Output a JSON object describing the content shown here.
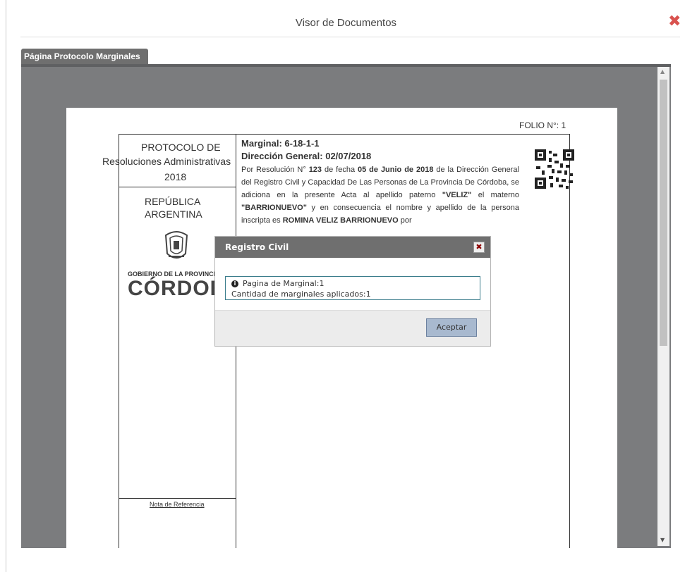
{
  "window": {
    "title": "Visor de Documentos",
    "close_icon": "close-icon",
    "close_color": "#d9534f"
  },
  "tabs": [
    {
      "label": "Página Protocolo Marginales",
      "active": true
    }
  ],
  "document": {
    "folio": "FOLIO N°: 1",
    "left_panel": {
      "protocol_line": "PROTOCOLO DE",
      "resolution_line": "Resoluciones Administrativas",
      "year": "2018",
      "country_line1": "REPÚBLICA",
      "country_line2": "ARGENTINA",
      "government_label": "GOBIERNO DE LA PROVINCIA",
      "province": "CÓRDOBA",
      "reference_note": "Nota de Referencia"
    },
    "marginal": {
      "title": "Marginal: 6-18-1-1",
      "direction": "Dirección General: 02/07/2018",
      "text_parts": {
        "p1": "Por Resolución N° ",
        "b1": "123",
        "p2": " de fecha ",
        "b2": "05 de Junio de 2018",
        "p3": " de la Dirección General del Registro Civil y Capacidad De Las Personas de La Provincia De Córdoba, se adiciona en la presente Acta al apellido paterno ",
        "b3": "\"VELIZ\"",
        "p4": " el materno ",
        "b4": "\"BARRIONUEVO\"",
        "p5": " y en consecuencia el nombre y apellido de la persona inscripta es ",
        "b5": "ROMINA VELIZ BARRIONUEVO",
        "p6": " por"
      }
    }
  },
  "dialog": {
    "title": "Registro Civil",
    "message_line1": "Pagina de Marginal:1",
    "message_line2": "Cantidad de marginales aplicados:1",
    "accept_label": "Aceptar"
  },
  "colors": {
    "viewer_bg": "#7b7c7e",
    "tab_bg": "#6f6f6f",
    "button_bg": "#a8b9cf"
  }
}
